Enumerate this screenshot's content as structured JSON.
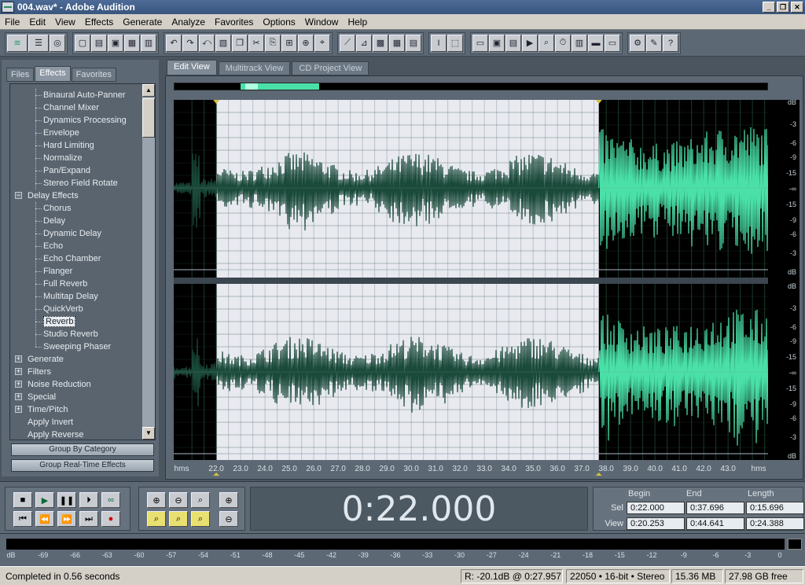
{
  "window": {
    "title": "004.wav* - Adobe Audition"
  },
  "menu": [
    "File",
    "Edit",
    "View",
    "Effects",
    "Generate",
    "Analyze",
    "Favorites",
    "Options",
    "Window",
    "Help"
  ],
  "left_tabs": [
    {
      "label": "Files",
      "active": false
    },
    {
      "label": "Effects",
      "active": true
    },
    {
      "label": "Favorites",
      "active": false
    }
  ],
  "tree": {
    "items": [
      {
        "label": "Binaural Auto-Panner",
        "type": "child"
      },
      {
        "label": "Channel Mixer",
        "type": "child"
      },
      {
        "label": "Dynamics Processing",
        "type": "child"
      },
      {
        "label": "Envelope",
        "type": "child"
      },
      {
        "label": "Hard Limiting",
        "type": "child"
      },
      {
        "label": "Normalize",
        "type": "child"
      },
      {
        "label": "Pan/Expand",
        "type": "child"
      },
      {
        "label": "Stereo Field Rotate",
        "type": "child"
      },
      {
        "label": "Delay Effects",
        "type": "cat",
        "sign": "−"
      },
      {
        "label": "Chorus",
        "type": "child"
      },
      {
        "label": "Delay",
        "type": "child"
      },
      {
        "label": "Dynamic Delay",
        "type": "child"
      },
      {
        "label": "Echo",
        "type": "child"
      },
      {
        "label": "Echo Chamber",
        "type": "child"
      },
      {
        "label": "Flanger",
        "type": "child"
      },
      {
        "label": "Full Reverb",
        "type": "child"
      },
      {
        "label": "Multitap Delay",
        "type": "child"
      },
      {
        "label": "QuickVerb",
        "type": "child"
      },
      {
        "label": "Reverb",
        "type": "child",
        "selected": true
      },
      {
        "label": "Studio Reverb",
        "type": "child"
      },
      {
        "label": "Sweeping Phaser",
        "type": "child"
      },
      {
        "label": "Generate",
        "type": "cat",
        "sign": "+"
      },
      {
        "label": "Filters",
        "type": "cat",
        "sign": "+"
      },
      {
        "label": "Noise Reduction",
        "type": "cat",
        "sign": "+"
      },
      {
        "label": "Special",
        "type": "cat",
        "sign": "+"
      },
      {
        "label": "Time/Pitch",
        "type": "cat",
        "sign": "+"
      },
      {
        "label": "Apply Invert",
        "type": "cat"
      },
      {
        "label": "Apply Reverse",
        "type": "cat"
      }
    ]
  },
  "group_buttons": {
    "by_category": "Group By Category",
    "real_time": "Group Real-Time Effects"
  },
  "view_tabs": [
    {
      "label": "Edit View",
      "active": true
    },
    {
      "label": "Multitrack View",
      "active": false
    },
    {
      "label": "CD Project View",
      "active": false
    }
  ],
  "waveform": {
    "selection": {
      "begin": 22.0,
      "end": 37.696
    },
    "view": {
      "begin": 20.253,
      "end": 44.641
    },
    "db_labels": [
      "dB",
      "-3",
      "-6",
      "-9",
      "-15",
      "-∞",
      "-15",
      "-9",
      "-6",
      "-3",
      "dB"
    ],
    "timeline_unit": "hms",
    "ticks": [
      "22.0",
      "23.0",
      "24.0",
      "25.0",
      "26.0",
      "27.0",
      "28.0",
      "29.0",
      "30.0",
      "31.0",
      "32.0",
      "33.0",
      "34.0",
      "35.0",
      "36.0",
      "37.0",
      "38.0",
      "39.0",
      "40.0",
      "41.0",
      "42.0",
      "43.0"
    ],
    "colors": {
      "selected_bg": "#e8eaf0",
      "unselected_bg": "#000000",
      "wave_selected": "#1a4a3a",
      "wave_unselected": "#4ae0a8",
      "grid": "#b8c0cc"
    }
  },
  "time_display": "0:22.000",
  "selection_panel": {
    "headers": {
      "begin": "Begin",
      "end": "End",
      "length": "Length"
    },
    "sel": {
      "label": "Sel",
      "begin": "0:22.000",
      "end": "0:37.696",
      "length": "0:15.696"
    },
    "view": {
      "label": "View",
      "begin": "0:20.253",
      "end": "0:44.641",
      "length": "0:24.388"
    }
  },
  "level_scale": [
    "dB",
    "-69",
    "-66",
    "-63",
    "-60",
    "-57",
    "-54",
    "-51",
    "-48",
    "-45",
    "-42",
    "-39",
    "-36",
    "-33",
    "-30",
    "-27",
    "-24",
    "-21",
    "-18",
    "-15",
    "-12",
    "-9",
    "-6",
    "-3",
    "0"
  ],
  "status": {
    "message": "Completed in 0.56 seconds",
    "cursor": "R: -20.1dB @   0:27.957",
    "format": "22050 • 16-bit • Stereo",
    "size": "15.36 MB",
    "free": "27.98 GB free"
  }
}
